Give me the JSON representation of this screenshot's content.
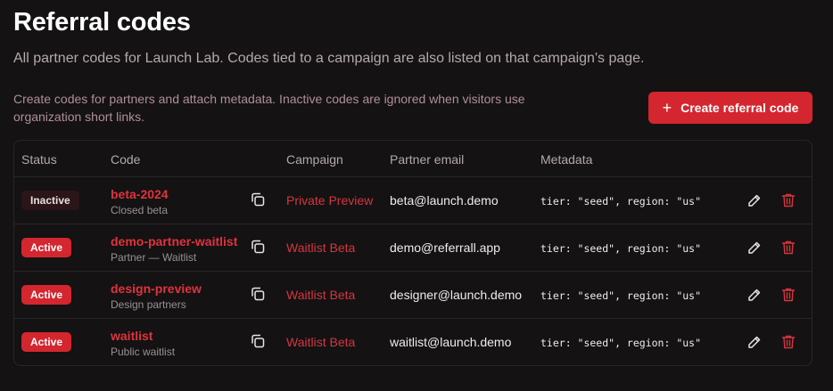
{
  "header": {
    "title": "Referral codes",
    "subtitle": "All partner codes for Launch Lab. Codes tied to a campaign are also listed on that campaign's page.",
    "intro": "Create codes for partners and attach metadata. Inactive codes are ignored when visitors use organization short links.",
    "create_button_label": "Create referral code",
    "create_button_icon": "plus-icon"
  },
  "colors": {
    "accent": "#d4262f",
    "background": "#141213",
    "inactive_badge": "#2b1518"
  },
  "table": {
    "columns": [
      "Status",
      "Code",
      "Campaign",
      "Partner email",
      "Metadata"
    ],
    "rows": [
      {
        "status": "Inactive",
        "code": "beta-2024",
        "description": "Closed beta",
        "campaign": "Private Preview",
        "email": "beta@launch.demo",
        "metadata": "tier: \"seed\", region: \"us\""
      },
      {
        "status": "Active",
        "code": "demo-partner-waitlist",
        "description": "Partner — Waitlist",
        "campaign": "Waitlist Beta",
        "email": "demo@referrall.app",
        "metadata": "tier: \"seed\", region: \"us\""
      },
      {
        "status": "Active",
        "code": "design-preview",
        "description": "Design partners",
        "campaign": "Waitlist Beta",
        "email": "designer@launch.demo",
        "metadata": "tier: \"seed\", region: \"us\""
      },
      {
        "status": "Active",
        "code": "waitlist",
        "description": "Public waitlist",
        "campaign": "Waitlist Beta",
        "email": "waitlist@launch.demo",
        "metadata": "tier: \"seed\", region: \"us\""
      }
    ],
    "row_icons": [
      "copy-icon",
      "pencil-icon",
      "trash-icon"
    ]
  }
}
